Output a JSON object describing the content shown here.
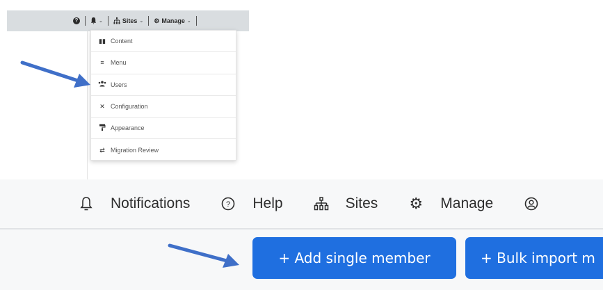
{
  "top_nav": {
    "sites": "Sites",
    "manage": "Manage"
  },
  "dropdown": {
    "items": [
      {
        "label": "Content",
        "icon": "book-icon"
      },
      {
        "label": "Menu",
        "icon": "hamburger-icon"
      },
      {
        "label": "Users",
        "icon": "users-icon"
      },
      {
        "label": "Configuration",
        "icon": "wrench-icon"
      },
      {
        "label": "Appearance",
        "icon": "paint-roller-icon"
      },
      {
        "label": "Migration Review",
        "icon": "arrows-swap-icon"
      }
    ]
  },
  "main_nav": {
    "notifications": "Notifications",
    "help": "Help",
    "sites": "Sites",
    "manage": "Manage"
  },
  "actions": {
    "add_single_member": "+ Add single member",
    "bulk_import": "+ Bulk import m"
  },
  "colors": {
    "primary_button": "#1f6fe0",
    "arrow": "#3f6fc8"
  }
}
